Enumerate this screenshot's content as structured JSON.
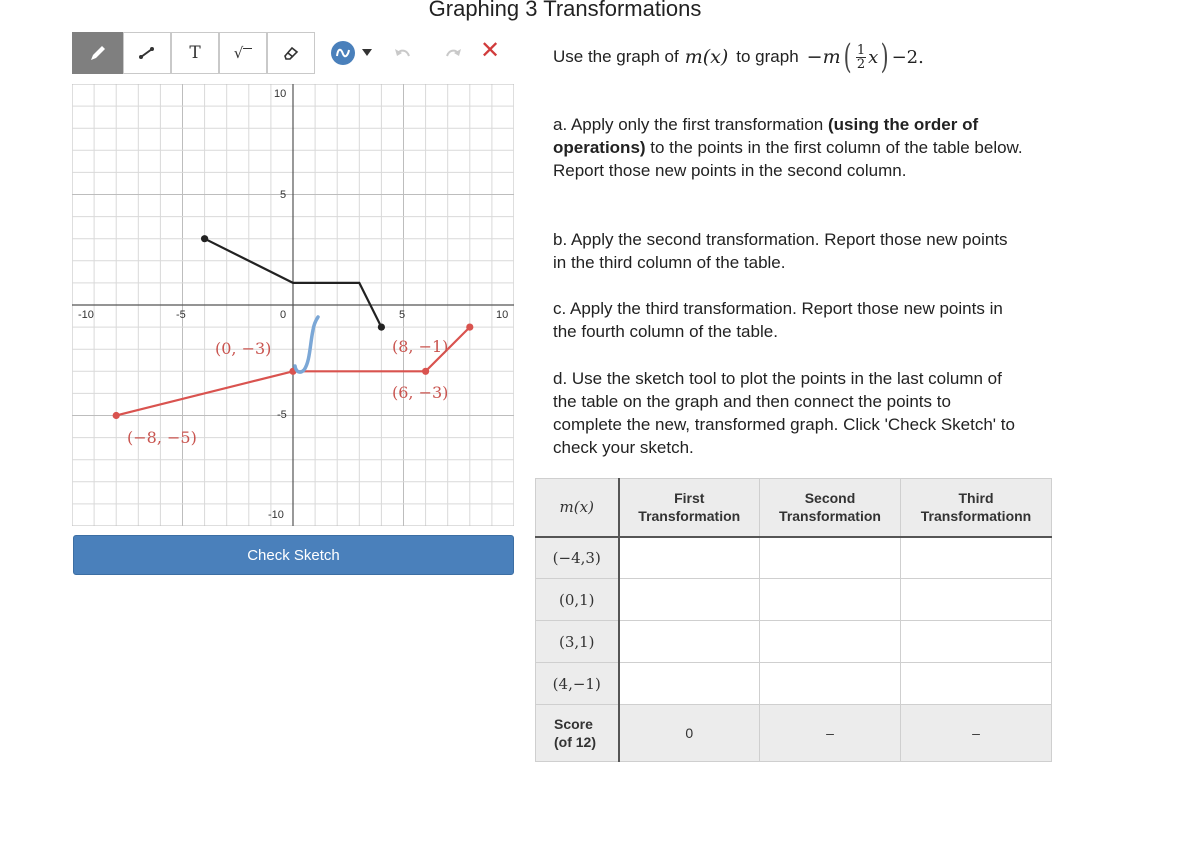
{
  "page": {
    "title": "Graphing 3 Transformations"
  },
  "toolbar": {
    "tools": [
      "pencil-tool",
      "line-tool",
      "text-tool",
      "sqrt-tool",
      "eraser-tool"
    ],
    "text_tool_label": "T",
    "sqrt_tool_label": "√",
    "close_label": "✕"
  },
  "graph": {
    "x_range": [
      -10,
      10
    ],
    "y_range": [
      -10,
      10
    ],
    "axis_labels": {
      "x_neg10": "-10",
      "x_neg5": "-5",
      "x_0": "0",
      "x_5": "5",
      "x_10": "10",
      "y_10": "10",
      "y_5": "5",
      "y_neg5": "-5",
      "y_neg10": "-10"
    },
    "black_graph_points": [
      [
        -4,
        3
      ],
      [
        0,
        1
      ],
      [
        3,
        1
      ],
      [
        4,
        -1
      ]
    ],
    "red_graph_points": [
      [
        -8,
        -5
      ],
      [
        0,
        -3
      ],
      [
        6,
        -3
      ],
      [
        8,
        -1
      ]
    ],
    "point_labels": [
      "(0, −3)",
      "(8, −1)",
      "(6, −3)",
      "(−8, −5)"
    ],
    "colors": {
      "black_graph": "#222222",
      "red_graph": "#d9534f",
      "sketch": "#7ba7d6",
      "grid": "#d9d9d9"
    }
  },
  "check_button": {
    "label": "Check Sketch"
  },
  "instructions": {
    "prompt_lead": "Use the graph of",
    "prompt_mid": "to graph",
    "func": "m(x)",
    "frac_num": "1",
    "frac_den": "2",
    "minus_m": "−m",
    "x_var": "x",
    "tail": "−2.",
    "a_prefix": "a. Apply only the first transformation ",
    "a_bold": "(using the order of operations)",
    "a_suffix": " to the points in the first column of the table below. Report those new points in the second column.",
    "b": "b. Apply the second transformation. Report those new points in the third column of the table.",
    "c": "c. Apply the third transformation. Report those new points in the fourth column of the table.",
    "d": "d. Use the sketch tool to plot the points in the last column of the table on the graph and then connect the points to complete the new, transformed graph. Click 'Check Sketch' to check your sketch."
  },
  "table": {
    "headers": {
      "col0": "m(x)",
      "col1_a": "First",
      "col1_b": "Transformation",
      "col2_a": "Second",
      "col2_b": "Transformation",
      "col3_a": "Third",
      "col3_b": "Transformationn"
    },
    "rows": [
      "(−4,3)",
      "(0,1)",
      "(3,1)",
      "(4,−1)"
    ],
    "score_label_a": "Score",
    "score_label_b": "(of 12)",
    "scores": [
      "0",
      "–",
      "–"
    ]
  }
}
